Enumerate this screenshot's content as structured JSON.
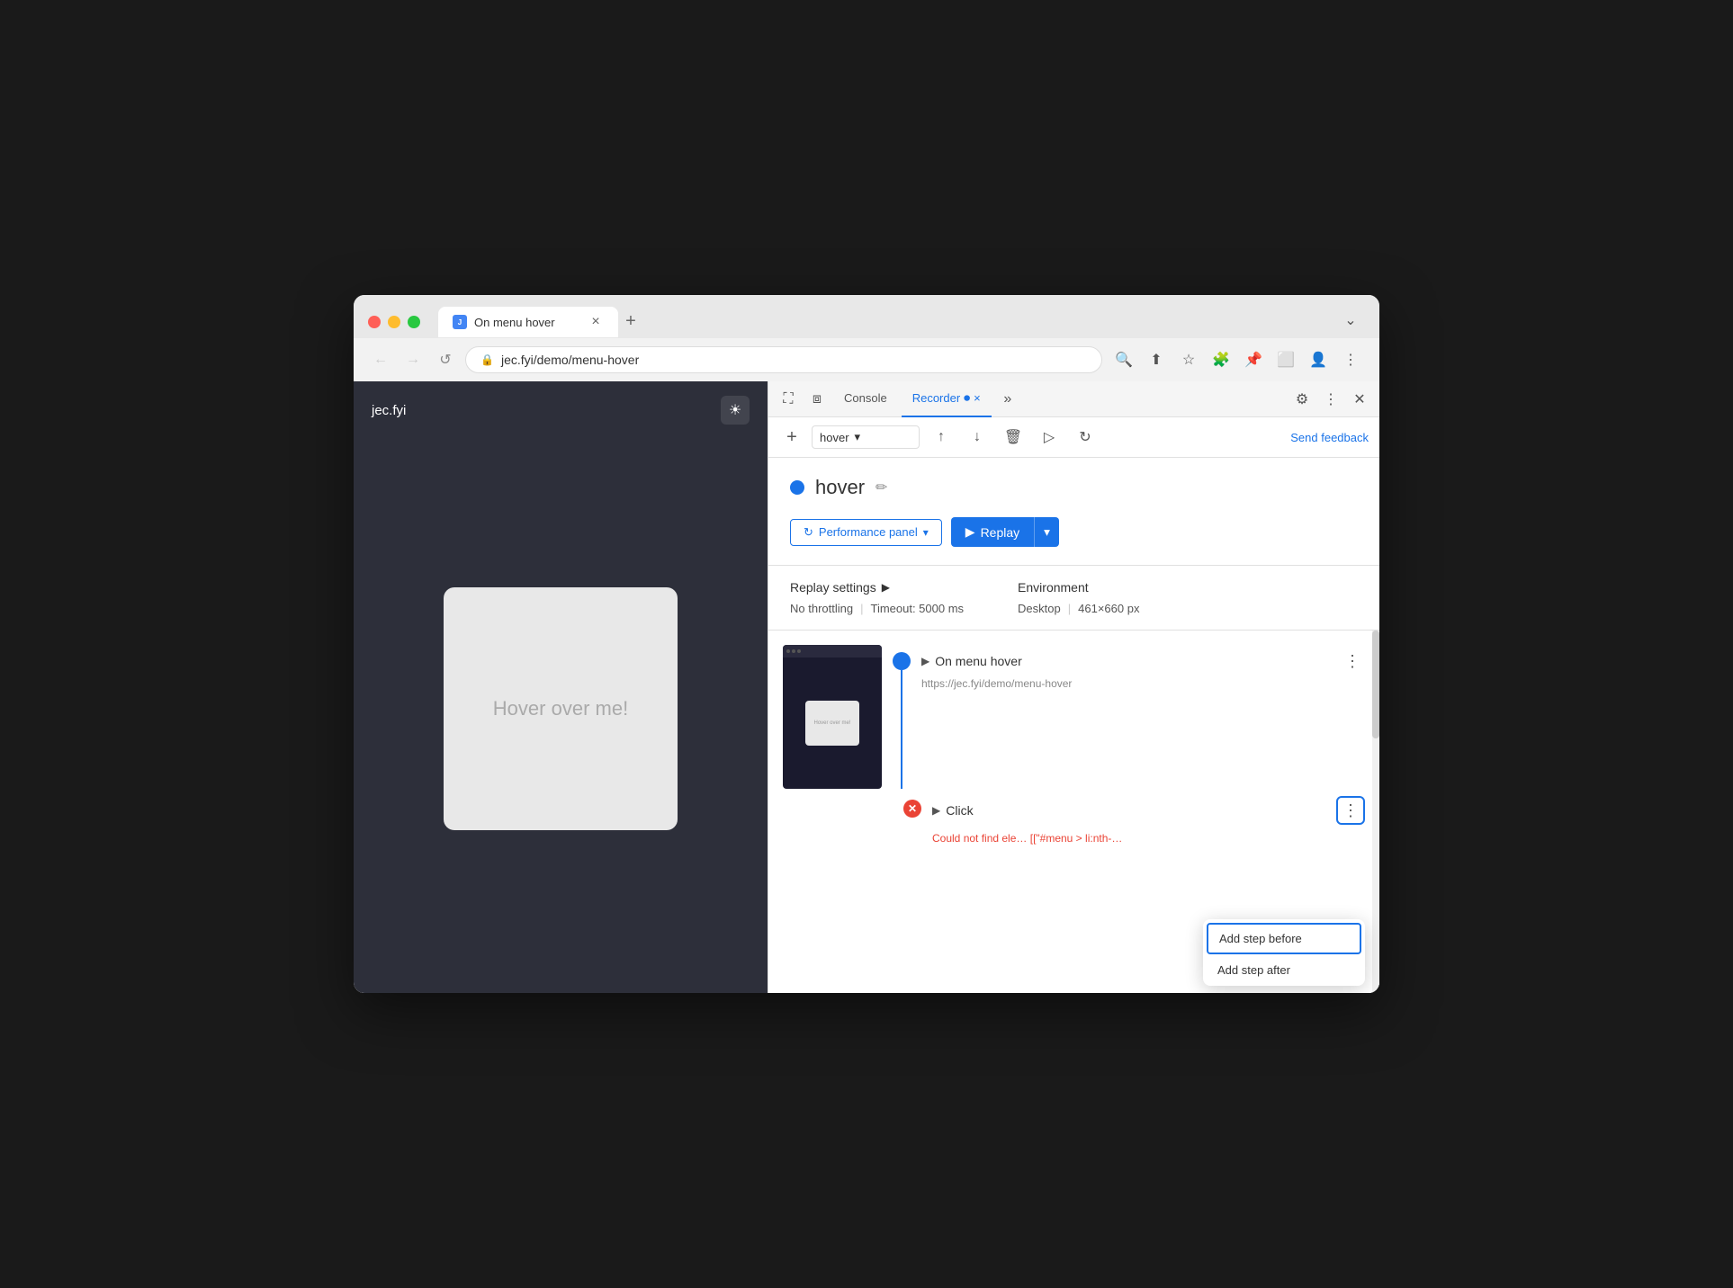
{
  "browser": {
    "traffic_lights": [
      "red",
      "yellow",
      "green"
    ],
    "tab": {
      "title": "On menu hover",
      "favicon_text": "J"
    },
    "new_tab_label": "+",
    "address": "jec.fyi/demo/menu-hover",
    "nav": {
      "back": "←",
      "forward": "→",
      "refresh": "↺"
    }
  },
  "page": {
    "site_title": "jec.fyi",
    "theme_icon": "☀",
    "hover_box_text": "Hover over me!"
  },
  "devtools": {
    "tabs": [
      {
        "label": "Console",
        "active": false
      },
      {
        "label": "Recorder",
        "active": true
      }
    ],
    "more_icon": "»",
    "settings_icon": "⚙",
    "more_btn_icon": "⋮",
    "close_icon": "✕",
    "cursor_icon": "⛶"
  },
  "recorder": {
    "add_btn": "+",
    "recording_name": "hover",
    "recording_dot_color": "#1a73e8",
    "upload_icon": "↑",
    "download_icon": "↓",
    "delete_icon": "🗑",
    "replay_step_icon": "▷",
    "replay_options_icon": "↻",
    "send_feedback_label": "Send feedback",
    "perf_panel_label": "Performance panel",
    "replay_label": "Replay",
    "edit_icon": "✏"
  },
  "settings": {
    "title": "Replay settings",
    "arrow": "▶",
    "throttling_label": "No throttling",
    "timeout_label": "Timeout: 5000 ms",
    "env_title": "Environment",
    "env_type": "Desktop",
    "env_size": "461×660 px"
  },
  "steps": {
    "step1": {
      "name": "On menu hover",
      "url": "https://jec.fyi/demo/menu-hover",
      "more_icon": "⋮",
      "expand_icon": "▶"
    },
    "step2": {
      "name": "Click",
      "expand_icon": "▶",
      "more_icon": "⋮",
      "error_text": "Could not find ele…  [[\"#menu > li:nth-…"
    }
  },
  "context_menu": {
    "items": [
      {
        "label": "Add step before",
        "highlighted": true
      },
      {
        "label": "Add step after",
        "highlighted": false
      }
    ]
  }
}
